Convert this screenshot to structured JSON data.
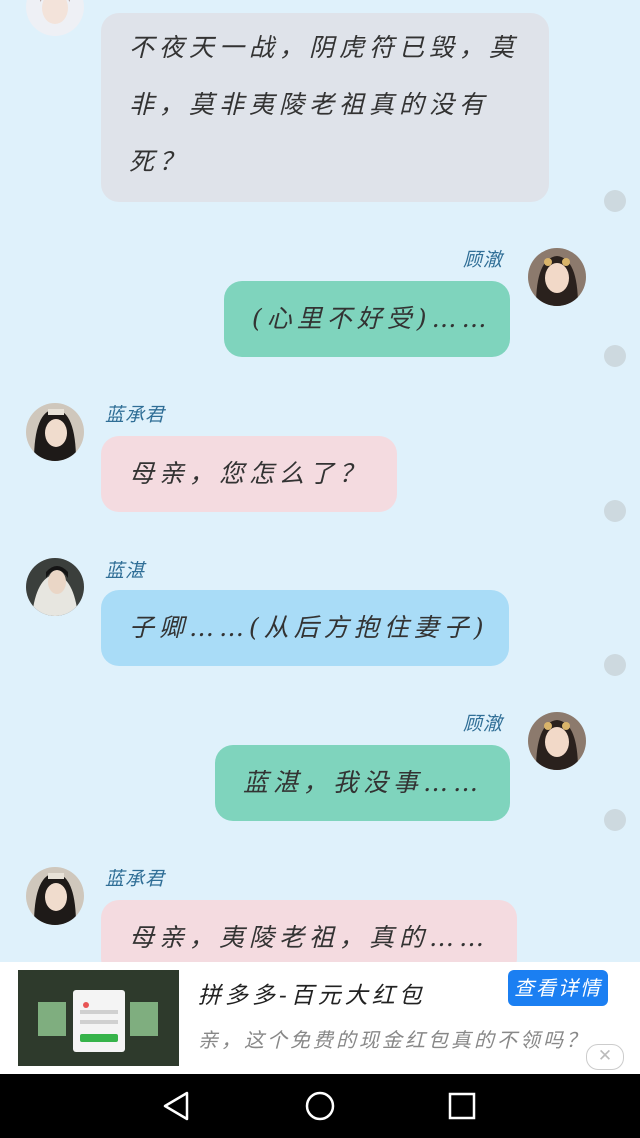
{
  "chat": {
    "messages": [
      {
        "side": "left",
        "speaker": "",
        "text": "不夜天一战，阴虎符已毁，莫非，莫非夷陵老祖真的没有死？",
        "color": "gray"
      },
      {
        "side": "right",
        "speaker": "顾澈",
        "text": "(心里不好受)……",
        "color": "teal"
      },
      {
        "side": "left",
        "speaker": "蓝承君",
        "text": "母亲，您怎么了？",
        "color": "pink"
      },
      {
        "side": "left",
        "speaker": "蓝湛",
        "text": "子卿……(从后方抱住妻子)",
        "color": "blue"
      },
      {
        "side": "right",
        "speaker": "顾澈",
        "text": "蓝湛，我没事……",
        "color": "teal"
      },
      {
        "side": "left",
        "speaker": "蓝承君",
        "text": "母亲，夷陵老祖，真的……",
        "color": "pink"
      }
    ]
  },
  "ad": {
    "title": "拼多多-百元大红包",
    "subtitle": "亲，这个免费的现金红包真的不领吗？",
    "button_label": "查看详情",
    "close_icon": "close-icon"
  },
  "nav": {
    "back_icon": "back-triangle-icon",
    "home_icon": "home-circle-icon",
    "recents_icon": "recents-square-icon"
  },
  "colors": {
    "background": "#dff1fb",
    "bubble_gray": "#dfe3ea",
    "bubble_teal": "#7fd4bd",
    "bubble_pink": "#f4dbe0",
    "bubble_blue": "#a9dcf7",
    "speaker_name": "#2f6e96",
    "ad_button": "#1b7ff2"
  }
}
